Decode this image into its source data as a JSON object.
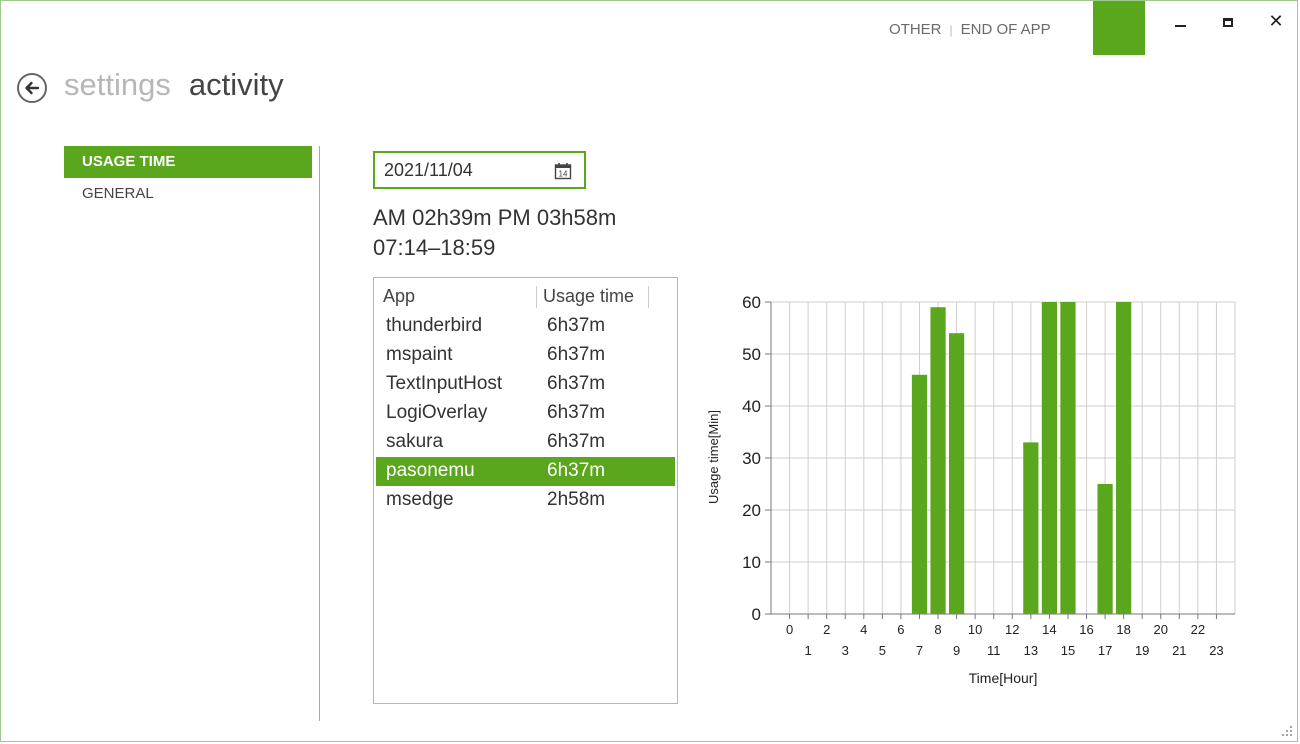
{
  "titlebar": {
    "links": [
      "OTHER",
      "END OF APP"
    ],
    "separator": "|",
    "accent_color": "#5aa61c"
  },
  "header": {
    "breadcrumb_parent": "settings",
    "title": "activity"
  },
  "sidebar": {
    "items": [
      {
        "label": "USAGE TIME",
        "active": true
      },
      {
        "label": "GENERAL",
        "active": false
      }
    ]
  },
  "date_picker": {
    "value": "2021/11/04",
    "icon_day": "14"
  },
  "summary": {
    "line1": "AM 02h39m PM 03h58m",
    "line2": "07:14–18:59"
  },
  "app_table": {
    "columns": [
      "App",
      "Usage time"
    ],
    "rows": [
      {
        "app": "thunderbird",
        "time": "6h37m",
        "selected": false
      },
      {
        "app": "mspaint",
        "time": "6h37m",
        "selected": false
      },
      {
        "app": "TextInputHost",
        "time": "6h37m",
        "selected": false
      },
      {
        "app": "LogiOverlay",
        "time": "6h37m",
        "selected": false
      },
      {
        "app": "sakura",
        "time": "6h37m",
        "selected": false
      },
      {
        "app": "pasonemu",
        "time": "6h37m",
        "selected": true
      },
      {
        "app": "msedge",
        "time": "2h58m",
        "selected": false
      }
    ]
  },
  "chart_data": {
    "type": "bar",
    "xlabel": "Time[Hour]",
    "ylabel": "Usage time[Min]",
    "ylim": [
      0,
      60
    ],
    "yticks": [
      0,
      10,
      20,
      30,
      40,
      50,
      60
    ],
    "categories": [
      "0",
      "1",
      "2",
      "3",
      "4",
      "5",
      "6",
      "7",
      "8",
      "9",
      "10",
      "11",
      "12",
      "13",
      "14",
      "15",
      "16",
      "17",
      "18",
      "19",
      "20",
      "21",
      "22",
      "23"
    ],
    "values": [
      0,
      0,
      0,
      0,
      0,
      0,
      0,
      46,
      59,
      54,
      0,
      0,
      0,
      33,
      60,
      60,
      0,
      25,
      60,
      0,
      0,
      0,
      0,
      0
    ],
    "grid": true,
    "color": "#5aa61c"
  }
}
